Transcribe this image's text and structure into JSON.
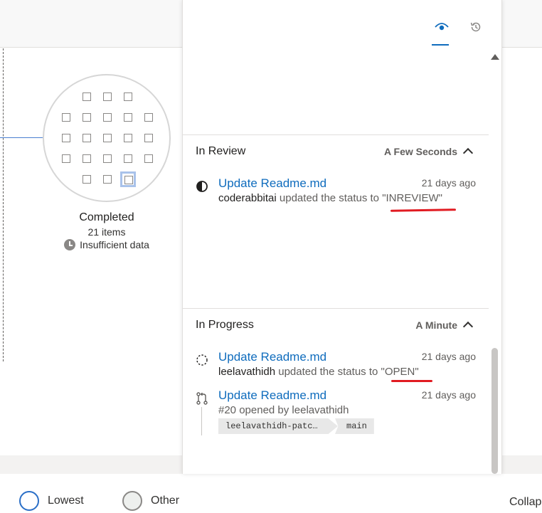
{
  "node": {
    "title": "Completed",
    "count": "21 items",
    "warning": "Insufficient data"
  },
  "legend": {
    "lowest": "Lowest",
    "other": "Other",
    "collapse": "Collap"
  },
  "panel": {
    "tabs": [
      {
        "icon": "eye-icon",
        "active": true
      },
      {
        "icon": "history-icon",
        "active": false
      }
    ],
    "sections": [
      {
        "title": "In Review",
        "time": "A Few Seconds",
        "items": [
          {
            "icon": "half-circle-status-icon",
            "title": "Update Readme.md",
            "ago": "21 days ago",
            "actor": "coderabbitai",
            "action": " updated the status to ",
            "status": "\"INREVIEW\""
          }
        ]
      },
      {
        "title": "In Progress",
        "time": "A Minute",
        "items": [
          {
            "icon": "dashed-circle-status-icon",
            "title": "Update Readme.md",
            "ago": "21 days ago",
            "actor": "leelavathidh",
            "action": " updated the status to ",
            "status": "\"OPEN\""
          },
          {
            "icon": "pull-request-icon",
            "title": "Update Readme.md",
            "ago": "21 days ago",
            "description": "#20 opened by leelavathidh",
            "source_branch": "leelavathidh-patc…",
            "target_branch": "main"
          }
        ]
      }
    ]
  },
  "colors": {
    "link": "#0f6cbd",
    "annotation": "#e11b22",
    "accent_ring": "#2b6fc7"
  }
}
